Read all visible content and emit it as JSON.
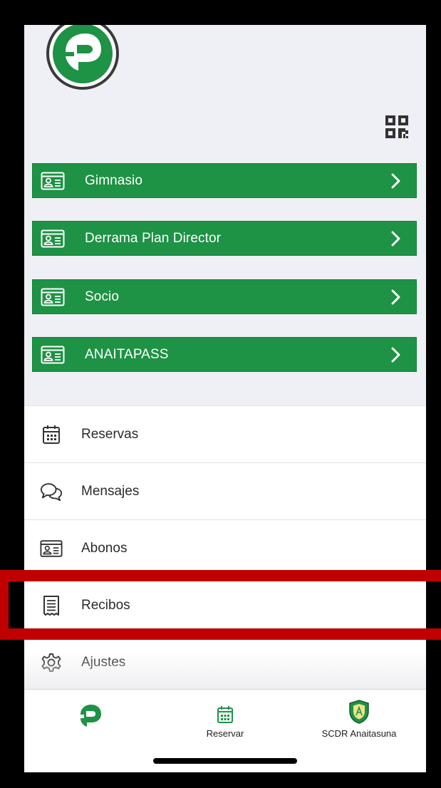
{
  "colors": {
    "accent": "#1e9245",
    "highlight": "#c00000"
  },
  "header": {
    "logo_icon": "app-logo",
    "qr_icon": "qr-code-icon"
  },
  "cards": [
    {
      "label": "Gimnasio",
      "icon": "id-card-icon"
    },
    {
      "label": "Derrama Plan Director",
      "icon": "id-card-icon"
    },
    {
      "label": "Socio",
      "icon": "id-card-icon"
    },
    {
      "label": "ANAITAPASS",
      "icon": "id-card-icon"
    }
  ],
  "menu": [
    {
      "label": "Reservas",
      "icon": "calendar-icon"
    },
    {
      "label": "Mensajes",
      "icon": "chat-icon"
    },
    {
      "label": "Abonos",
      "icon": "id-card-icon"
    },
    {
      "label": "Recibos",
      "icon": "receipt-icon"
    },
    {
      "label": "Ajustes",
      "icon": "gear-icon"
    }
  ],
  "tabbar": {
    "tabs": [
      {
        "label": "",
        "icon": "app-logo-icon"
      },
      {
        "label": "Reservar",
        "icon": "calendar-icon"
      },
      {
        "label": "SCDR Anaitasuna",
        "icon": "club-shield-icon"
      }
    ]
  }
}
